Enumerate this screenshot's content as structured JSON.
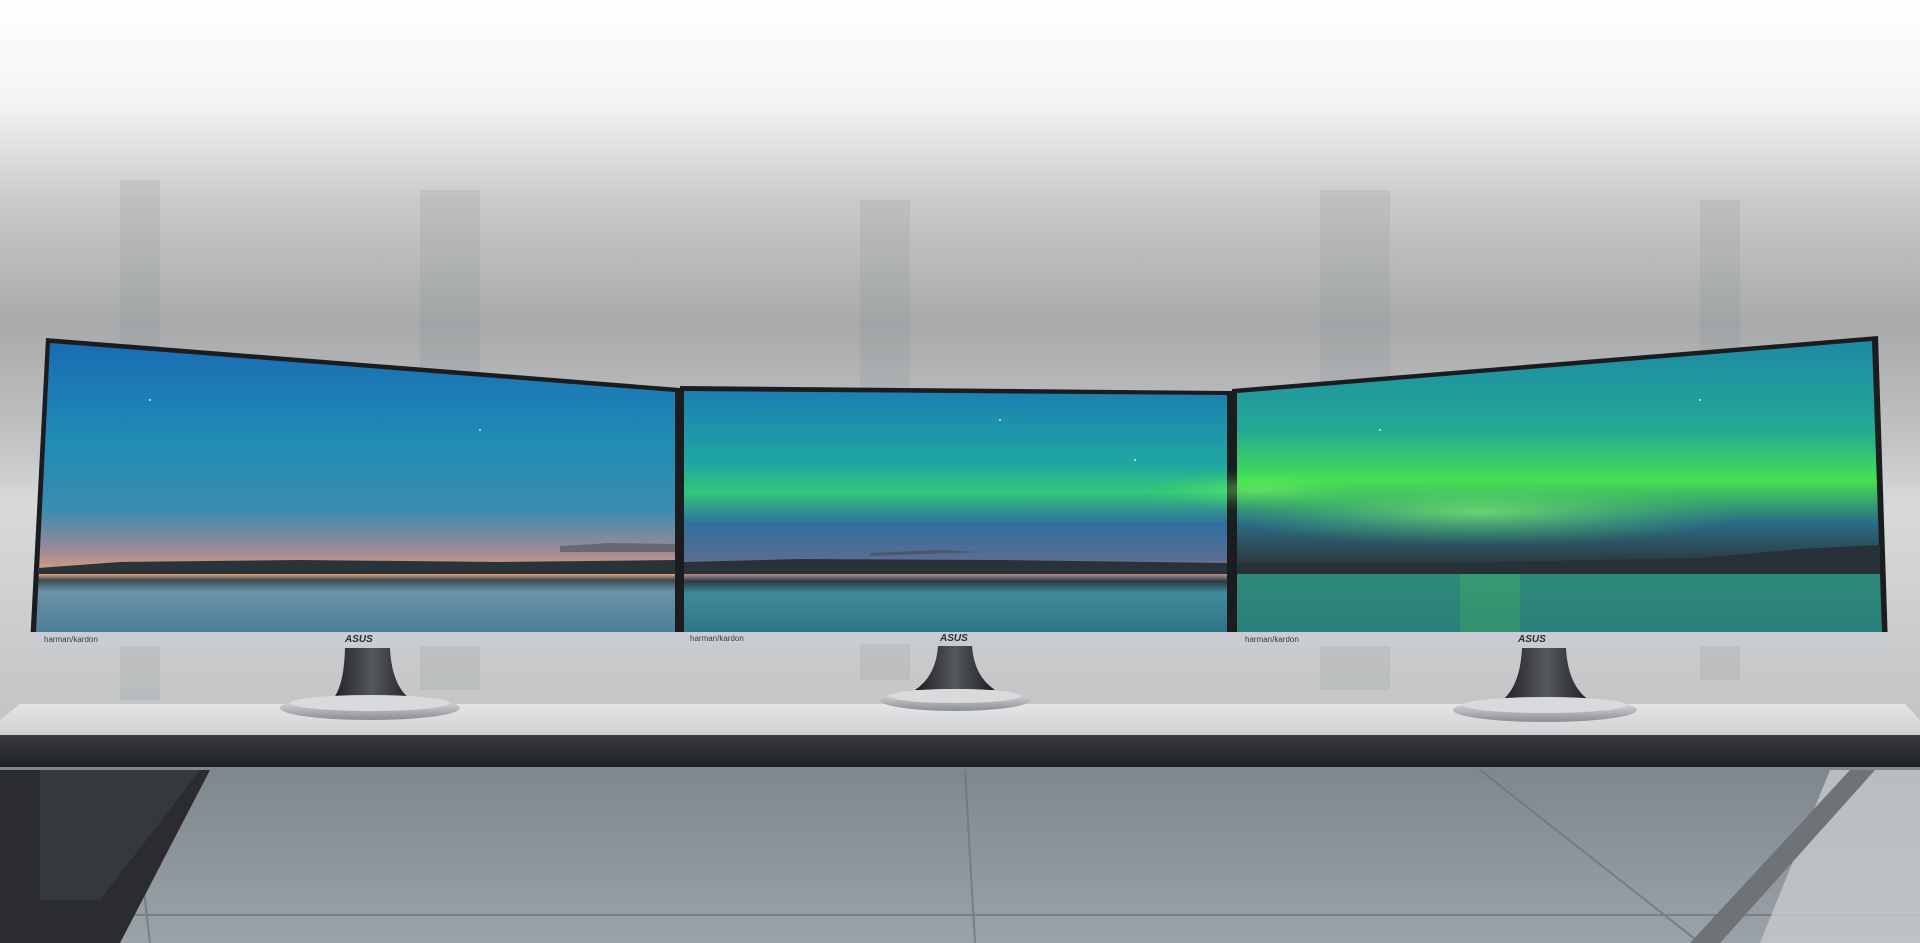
{
  "scene": {
    "description_free": true,
    "monitors": [
      {
        "id": "left",
        "bezel_text": "harman/kardon",
        "brand": "ASUS"
      },
      {
        "id": "center",
        "bezel_text": "harman/kardon",
        "brand": "ASUS"
      },
      {
        "id": "right",
        "bezel_text": "harman/kardon",
        "brand": "ASUS"
      }
    ],
    "colors": {
      "sky_top": "#1d6fb0",
      "sky_mid": "#21a4a0",
      "aurora": "#3dea4a",
      "horizon_glow": "#d79a7b",
      "water": "#3f7f96",
      "bezel": "#c9ccd0",
      "wall": "#a9abad",
      "desk": "#2b2d31",
      "floor": "#8b9398"
    }
  }
}
